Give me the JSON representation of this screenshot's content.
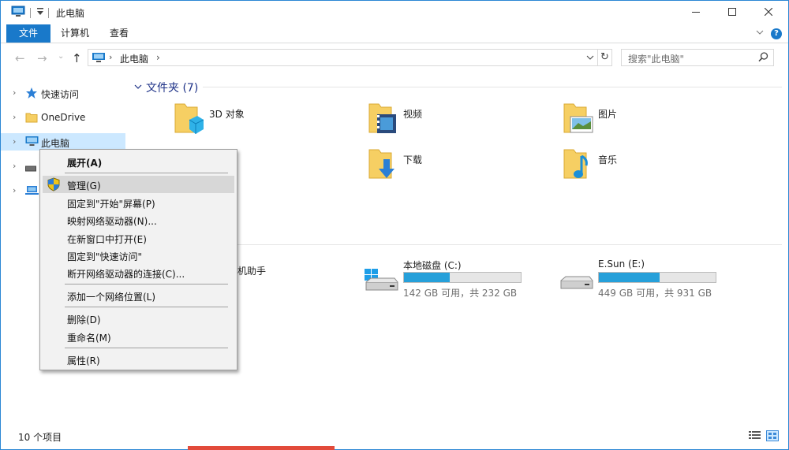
{
  "window": {
    "title": "此电脑"
  },
  "ribbon": {
    "tabs": [
      "文件",
      "计算机",
      "查看"
    ],
    "help": "?"
  },
  "address": {
    "location": "此电脑",
    "search_placeholder": "搜索\"此电脑\""
  },
  "nav": {
    "items": [
      {
        "label": "快速访问",
        "icon": "star-icon"
      },
      {
        "label": "OneDrive",
        "icon": "folder-icon"
      },
      {
        "label": "此电脑",
        "icon": "computer-icon"
      },
      {
        "label": "",
        "icon": "drive-icon"
      },
      {
        "label": "",
        "icon": "network-icon"
      }
    ]
  },
  "content": {
    "folders_header": "文件夹 (7)",
    "folders": [
      {
        "label": "3D 对象",
        "icon": "3d-objects-icon"
      },
      {
        "label": "视频",
        "icon": "video-folder-icon"
      },
      {
        "label": "图片",
        "icon": "pictures-folder-icon"
      },
      {
        "label": "下载",
        "icon": "downloads-folder-icon"
      },
      {
        "label": "音乐",
        "icon": "music-folder-icon"
      }
    ],
    "partial_device_label": "机助手",
    "drives": [
      {
        "name": "本地磁盘 (C:)",
        "space": "142 GB 可用，共 232 GB",
        "used_fraction": 0.39,
        "icon": "windows-drive-icon"
      },
      {
        "name": "E.Sun (E:)",
        "space": "449 GB 可用，共 931 GB",
        "used_fraction": 0.52,
        "icon": "drive-icon"
      }
    ]
  },
  "context_menu": {
    "items": [
      {
        "label": "展开(A)",
        "bold": true
      },
      {
        "label": "管理(G)",
        "icon": "shield-icon",
        "highlight": true
      },
      {
        "label": "固定到\"开始\"屏幕(P)"
      },
      {
        "label": "映射网络驱动器(N)..."
      },
      {
        "label": "在新窗口中打开(E)"
      },
      {
        "label": "固定到\"快速访问\""
      },
      {
        "label": "断开网络驱动器的连接(C)..."
      },
      {
        "label": "添加一个网络位置(L)"
      },
      {
        "label": "删除(D)"
      },
      {
        "label": "重命名(M)"
      },
      {
        "label": "属性(R)"
      }
    ]
  },
  "status": {
    "count": "10 个项目"
  },
  "colors": {
    "accent": "#1979ca",
    "selection": "#cce8ff",
    "drive_fill": "#26a0da",
    "header_text": "#1e3287"
  }
}
